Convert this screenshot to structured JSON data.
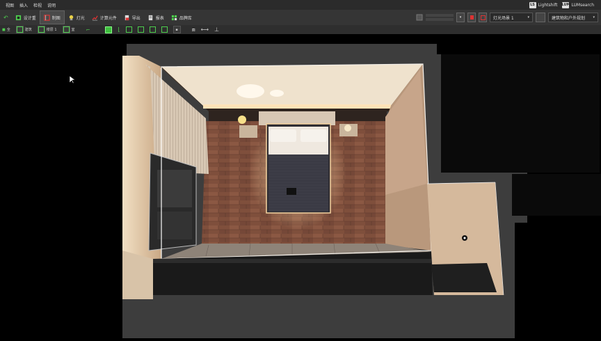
{
  "menu": {
    "items": [
      "视图",
      "插入",
      "检视",
      "说明"
    ],
    "plugins": [
      {
        "badge": "LS",
        "label": "Lightshift"
      },
      {
        "badge": "LUM",
        "label": "LUMsearch"
      }
    ]
  },
  "toolbar": {
    "buttons": [
      {
        "label": "设计重"
      },
      {
        "label": "制图"
      },
      {
        "label": "灯光"
      },
      {
        "label": "计算元件"
      },
      {
        "label": "导出"
      },
      {
        "label": "报表"
      },
      {
        "label": "品牌库"
      }
    ],
    "status_small": "",
    "light_scene": "灯光场景 1",
    "building_filter": "建筑物和户外规划"
  },
  "subbar": {
    "item1": "全",
    "item2": "建筑",
    "floor": "楼层 1",
    "item4": "室"
  },
  "colors": {
    "accent_green": "#3fbf3f",
    "floor_wood": "#8a5a45",
    "wall_light": "#d9c3a6"
  }
}
